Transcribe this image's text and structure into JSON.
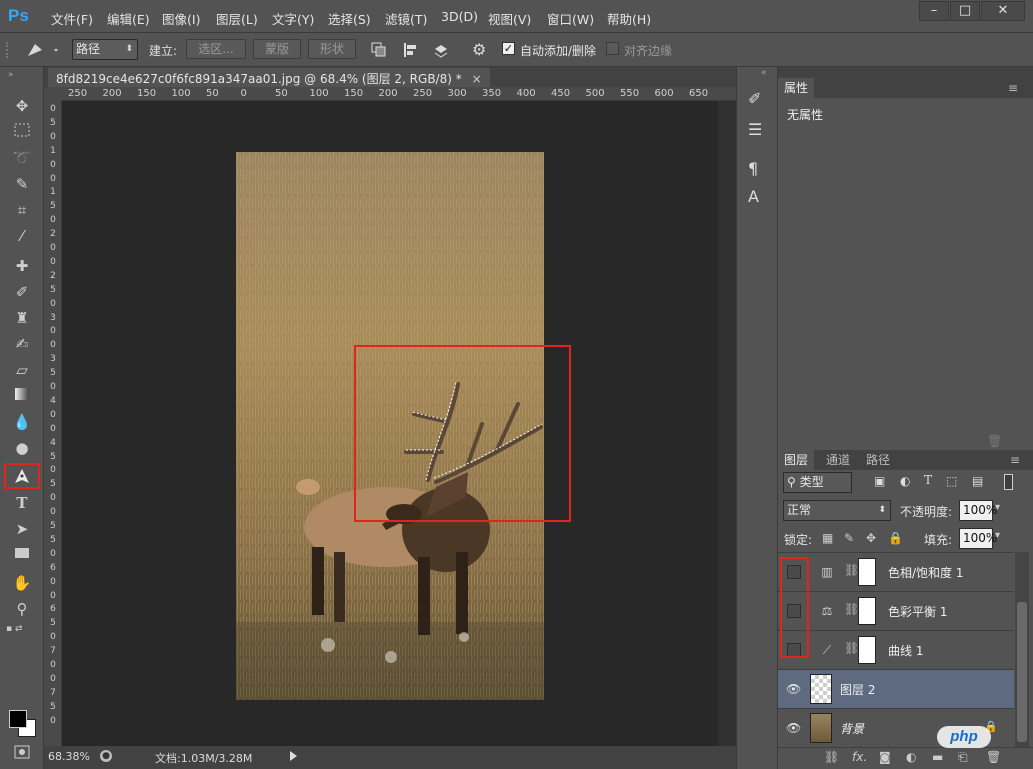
{
  "app": {
    "logo": "Ps"
  },
  "menubar": {
    "items": [
      "文件(F)",
      "编辑(E)",
      "图像(I)",
      "图层(L)",
      "文字(Y)",
      "选择(S)",
      "滤镜(T)",
      "3D(D)",
      "视图(V)",
      "窗口(W)",
      "帮助(H)"
    ],
    "window_controls": [
      "–",
      "□",
      "✕"
    ]
  },
  "options_bar": {
    "mode_value": "路径",
    "make_label": "建立:",
    "selection_button": "选区...",
    "mask_button": "蒙版",
    "shape_button": "形状",
    "auto_add_label": "自动添加/删除",
    "auto_add_checked": true,
    "align_edges_label": "对齐边缘",
    "align_edges_checked": false
  },
  "document": {
    "tab_title": "8fd8219ce4e627c0f6fc891a347aa01.jpg @ 68.4% (图层 2, RGB/8) *",
    "close_glyph": "×",
    "ruler_h": [
      "250",
      "200",
      "150",
      "100",
      "50",
      "0",
      "50",
      "100",
      "150",
      "200",
      "250",
      "300",
      "350",
      "400",
      "450",
      "500",
      "550",
      "600",
      "650"
    ],
    "ruler_v": [
      "0",
      "5",
      "0",
      "1",
      "0",
      "0",
      "1",
      "5",
      "0",
      "2",
      "0",
      "0",
      "2",
      "5",
      "0",
      "3",
      "0",
      "0",
      "3",
      "5",
      "0",
      "4",
      "0",
      "0",
      "4",
      "5",
      "0",
      "5",
      "0",
      "0",
      "5",
      "5",
      "0",
      "6",
      "0",
      "0",
      "6",
      "5",
      "0",
      "7",
      "0",
      "0",
      "7",
      "5",
      "0"
    ]
  },
  "statusbar": {
    "zoom": "68.38%",
    "doc_info": "文档:1.03M/3.28M"
  },
  "properties": {
    "tab": "属性",
    "content": "无属性"
  },
  "layers_panel": {
    "tabs": [
      "图层",
      "通道",
      "路径"
    ],
    "filter_kind": "类型",
    "blend_mode": "正常",
    "opacity_label": "不透明度:",
    "opacity_value": "100%",
    "lock_label": "锁定:",
    "fill_label": "填充:",
    "fill_value": "100%",
    "layers": [
      {
        "name": "色相/饱和度 1",
        "visible": false
      },
      {
        "name": "色彩平衡 1",
        "visible": false
      },
      {
        "name": "曲线 1",
        "visible": false
      },
      {
        "name": "图层 2",
        "visible": true
      },
      {
        "name": "背景",
        "visible": true
      }
    ]
  },
  "watermark": "php",
  "colors": {
    "accent": "#31a8ff",
    "highlight": "#e0251b",
    "selected_layer": "#5d6a80"
  }
}
